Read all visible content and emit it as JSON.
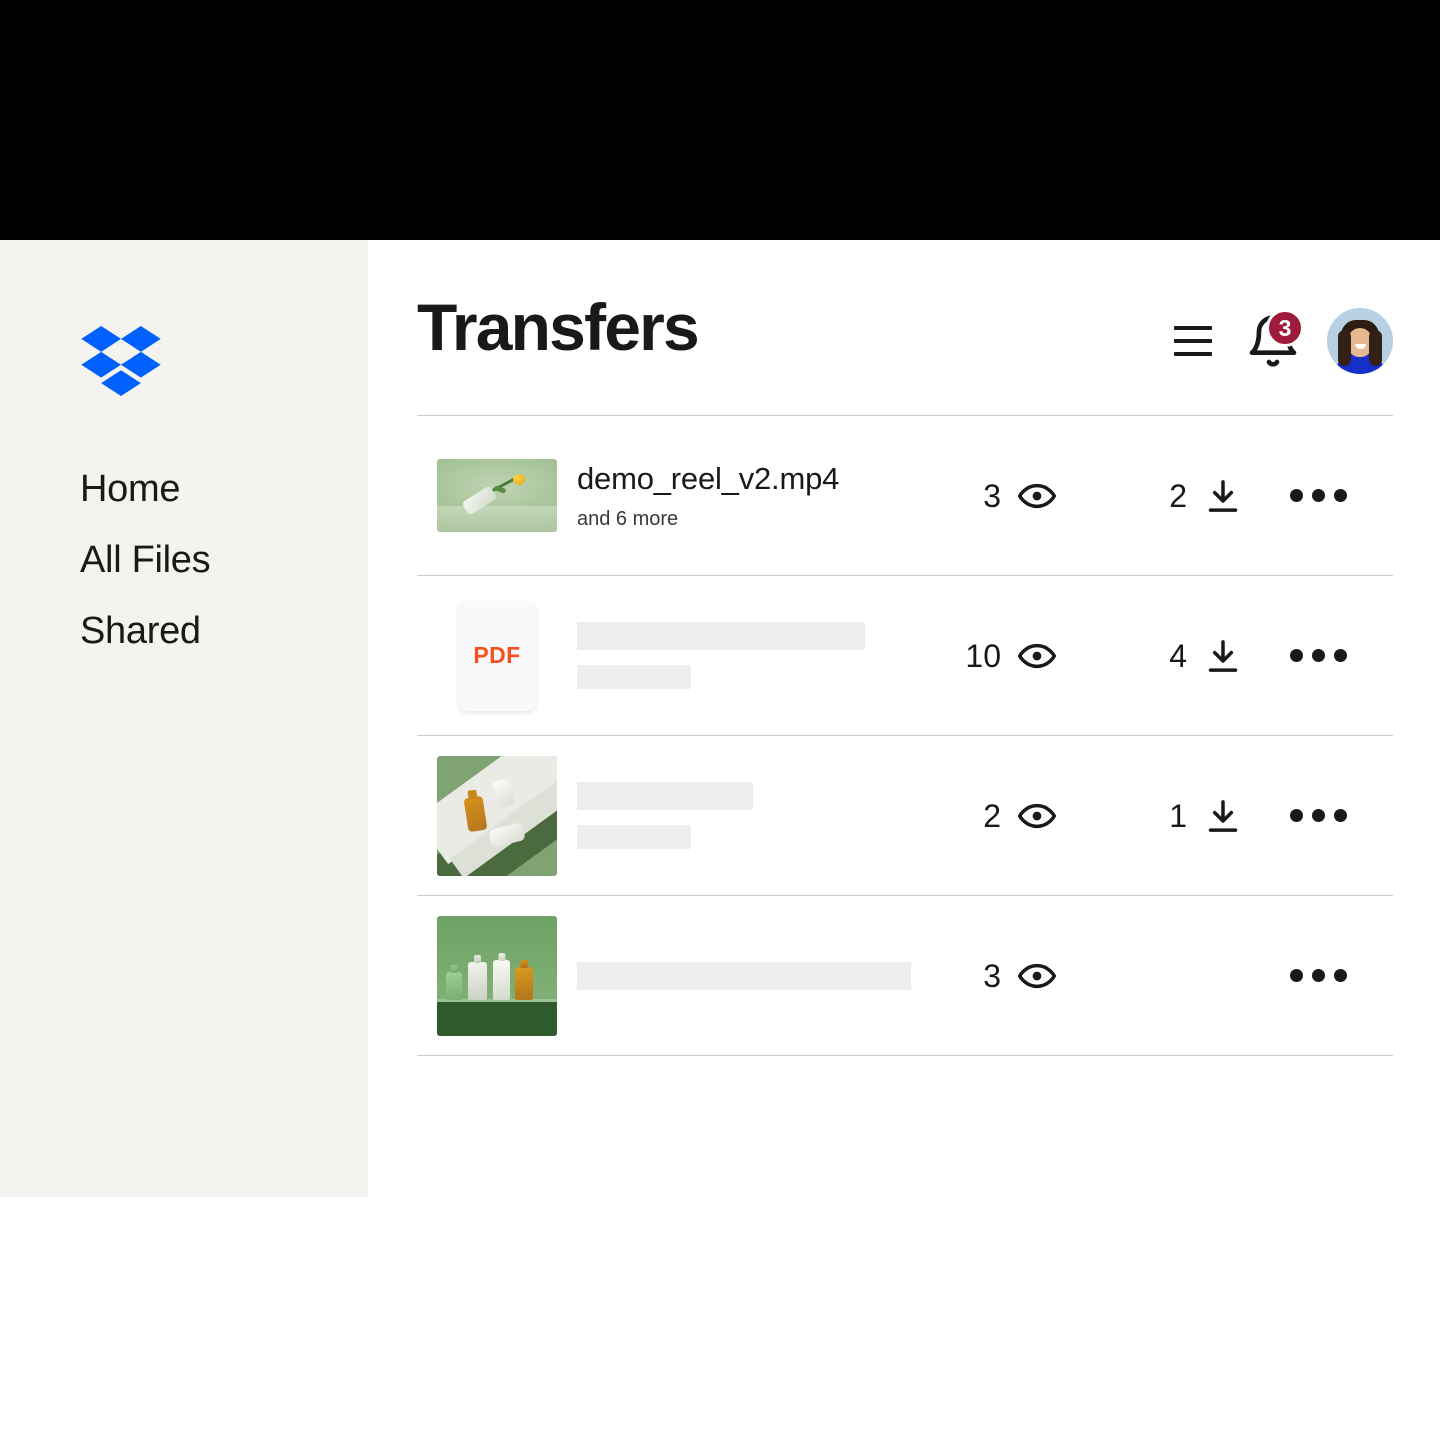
{
  "brand": {
    "logo_icon": "dropbox-logo-icon",
    "accent_blue": "#0061FE",
    "sidebar_bg": "#F4F3EF",
    "text_color": "#1A1918"
  },
  "sidebar": {
    "items": [
      {
        "label": "Home",
        "name": "sidebar-item-home"
      },
      {
        "label": "All Files",
        "name": "sidebar-item-all-files"
      },
      {
        "label": "Shared",
        "name": "sidebar-item-shared"
      }
    ]
  },
  "header": {
    "title": "Transfers",
    "menu_icon": "hamburger-menu-icon",
    "bell_icon": "notification-bell-icon",
    "notification_count": "3",
    "badge_color": "#9E1B3C",
    "avatar_icon": "user-avatar"
  },
  "list": {
    "views_icon": "eye-icon",
    "downloads_icon": "download-icon",
    "overflow_icon": "more-options-icon",
    "rows": [
      {
        "thumbnail": "video-thumbnail",
        "name": "demo_reel_v2.mp4",
        "subtitle": "and 6 more",
        "views": "3",
        "downloads": "2",
        "has_downloads": true,
        "placeholder": false
      },
      {
        "thumbnail": "pdf-file-icon",
        "pdf_label": "PDF",
        "pdf_label_color": "#F4511E",
        "name": "",
        "subtitle": "",
        "views": "10",
        "downloads": "4",
        "has_downloads": true,
        "placeholder": true,
        "placeholder_widths": [
          "288px",
          "114px"
        ]
      },
      {
        "thumbnail": "product-flatlay-thumbnail",
        "name": "",
        "subtitle": "",
        "views": "2",
        "downloads": "1",
        "has_downloads": true,
        "placeholder": true,
        "placeholder_widths": [
          "176px",
          "114px"
        ]
      },
      {
        "thumbnail": "bottles-shelf-thumbnail",
        "name": "",
        "subtitle": "",
        "views": "3",
        "downloads": "",
        "has_downloads": false,
        "placeholder": true,
        "placeholder_widths": [
          "334px"
        ]
      }
    ]
  }
}
